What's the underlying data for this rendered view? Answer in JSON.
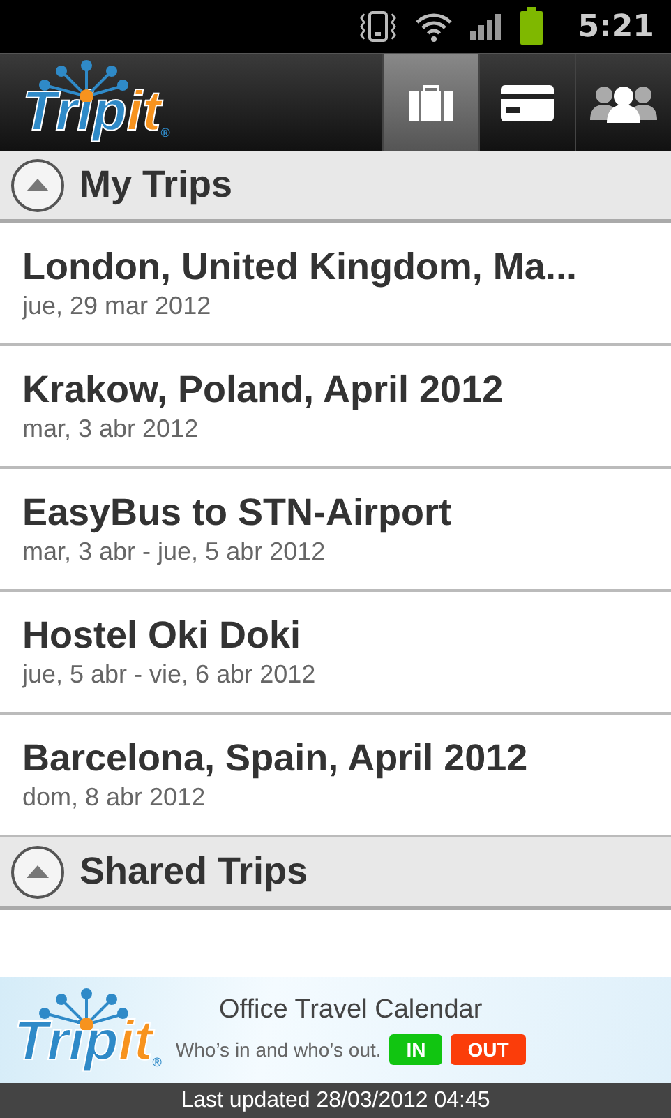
{
  "status_bar": {
    "time": "5:21"
  },
  "header": {
    "logo": {
      "text": "Trip",
      "accent": "it",
      "mark": "®"
    },
    "tabs": [
      {
        "kind": "suitcase",
        "selected": true
      },
      {
        "kind": "card",
        "selected": false
      },
      {
        "kind": "people",
        "selected": false
      }
    ]
  },
  "sections": [
    {
      "title": "My Trips",
      "expanded": true,
      "trips": [
        {
          "name": "London, United Kingdom, Ma...",
          "dates": "jue, 29 mar 2012"
        },
        {
          "name": "Krakow, Poland, April 2012",
          "dates": "mar, 3 abr 2012"
        },
        {
          "name": "EasyBus to STN-Airport",
          "dates": "mar, 3 abr - jue, 5 abr 2012"
        },
        {
          "name": "Hostel Oki Doki",
          "dates": "jue, 5 abr - vie, 6 abr 2012"
        },
        {
          "name": "Barcelona, Spain, April 2012",
          "dates": "dom, 8 abr 2012"
        }
      ]
    },
    {
      "title": "Shared Trips",
      "expanded": true
    }
  ],
  "ad": {
    "logo": {
      "text": "Trip",
      "accent": "it",
      "mark": "®"
    },
    "title": "Office Travel Calendar",
    "subtitle": "Who’s in and who’s out.",
    "buttons": [
      {
        "label": "IN",
        "color": "#11c511"
      },
      {
        "label": "OUT",
        "color": "#fb3d0a"
      }
    ]
  },
  "footer": "Last updated 28/03/2012 04:45"
}
